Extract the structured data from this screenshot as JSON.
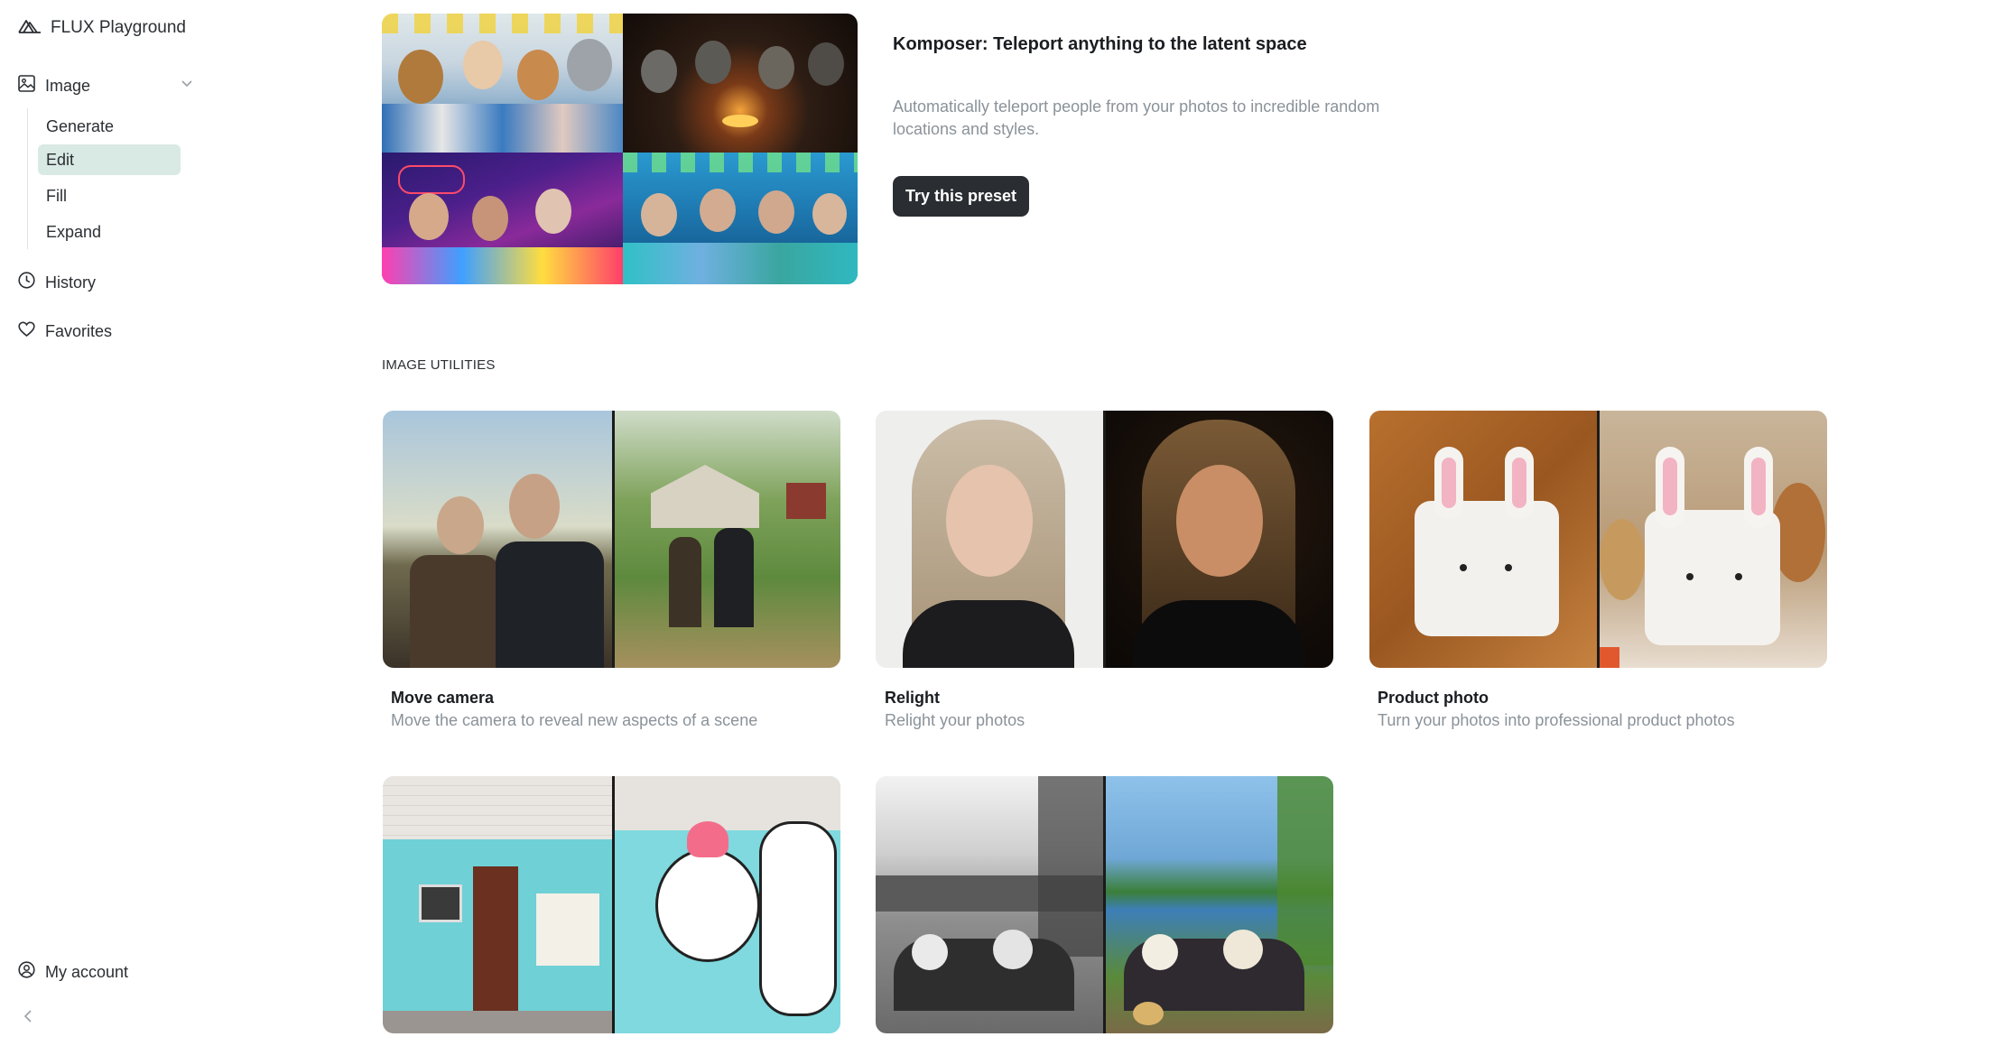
{
  "brand": {
    "name": "FLUX Playground"
  },
  "sidebar": {
    "image_label": "Image",
    "sub_items": [
      "Generate",
      "Edit",
      "Fill",
      "Expand"
    ],
    "active_sub_item": "Edit",
    "history_label": "History",
    "favorites_label": "Favorites",
    "account_label": "My account"
  },
  "hero": {
    "title": "Komposer: Teleport anything to the latent space",
    "description": "Automatically teleport people from your photos to incredible random locations and styles.",
    "button_label": "Try this preset"
  },
  "section": {
    "label": "IMAGE UTILITIES"
  },
  "cards": [
    {
      "title": "Move camera",
      "subtitle": "Move the camera to reveal new aspects of a scene"
    },
    {
      "title": "Relight",
      "subtitle": "Relight your photos"
    },
    {
      "title": "Product photo",
      "subtitle": "Turn your photos into professional product photos"
    }
  ],
  "colors": {
    "active_bg": "#d9e9e3",
    "button_bg": "#2a2d31",
    "muted_text": "#8a9299"
  },
  "icons": [
    "flux-logo-icon",
    "image-icon",
    "chevron-down-icon",
    "clock-icon",
    "heart-icon",
    "user-circle-icon",
    "chevron-left-icon"
  ]
}
